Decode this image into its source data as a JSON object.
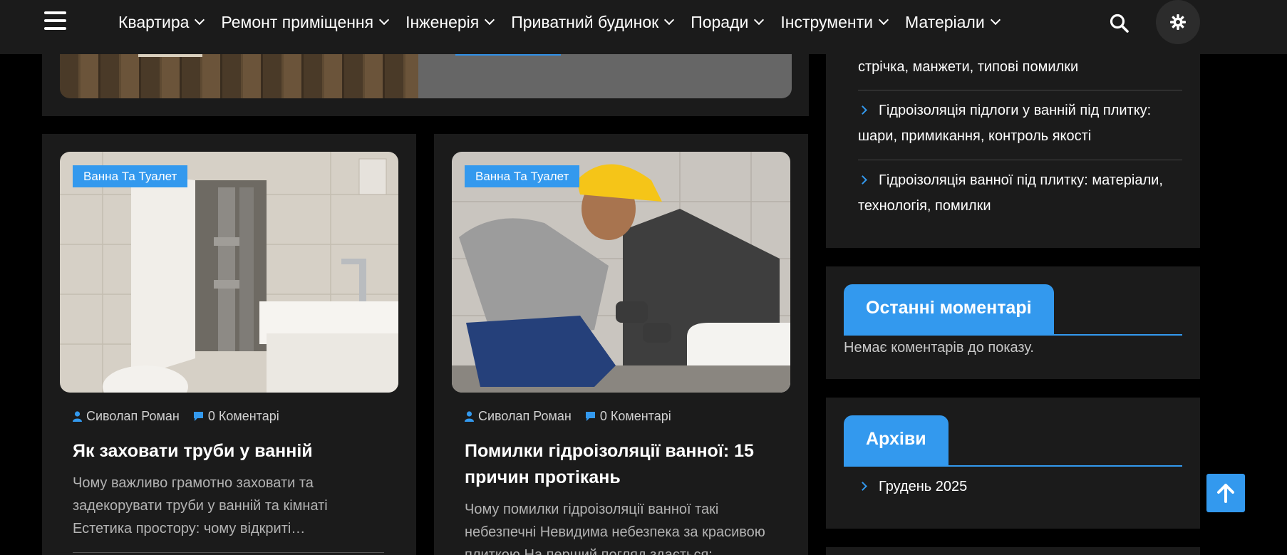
{
  "nav": {
    "items": [
      {
        "label": "Квартира"
      },
      {
        "label": "Ремонт приміщення"
      },
      {
        "label": "Інженерія"
      },
      {
        "label": "Приватний будинок"
      },
      {
        "label": "Поради"
      },
      {
        "label": "Інструменти"
      },
      {
        "label": "Матеріали"
      }
    ],
    "icons": {
      "menu": "hamburger-icon",
      "search": "search-icon",
      "theme": "sun-gear-icon",
      "dropdown": "chevron-down-icon"
    }
  },
  "posts": [
    {
      "category": "Ванна Та Туалет",
      "author": "Сиволап Роман",
      "comments": "0 Коментарі",
      "title": "Як заховати труби у ванній",
      "excerpt": "Чому важливо грамотно заховати та задекорувати труби у ванній та кімнаті Естетика простору: чому відкриті…"
    },
    {
      "category": "Ванна Та Туалет",
      "author": "Сиволап Роман",
      "comments": "0 Коментарі",
      "title": "Помилки гідроізоляції ванної: 15 причин протікань",
      "excerpt": "Чому помилки гідроізоляції ванної такі небезпечні Невидима небезпека за красивою плиткою На перший погляд здається:"
    }
  ],
  "sidebar": {
    "recent_posts": [
      {
        "label": "стрічка, манжети, типові помилки"
      },
      {
        "label": "Гідроізоляція підлоги у ванній під плитку: шари, примикання, контроль якості"
      },
      {
        "label": "Гідроізоляція ванної під плитку: матеріали, технологія, помилки"
      }
    ],
    "comments_widget": {
      "title": "Останні моментарі",
      "empty_text": "Немає коментарів до показу."
    },
    "archives_widget": {
      "title": "Архіви",
      "items": [
        {
          "label": "Грудень 2025"
        }
      ]
    }
  },
  "colors": {
    "accent": "#3399ee",
    "background": "#000000",
    "card": "#1b1b1b"
  }
}
